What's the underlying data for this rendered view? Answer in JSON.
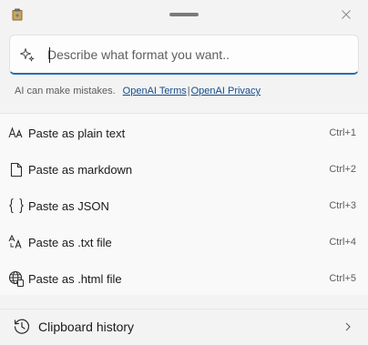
{
  "prompt": {
    "placeholder": "Describe what format you want..",
    "value": ""
  },
  "disclaimer": {
    "text": "AI can make mistakes.",
    "terms_link": "OpenAI Terms",
    "separator": "|",
    "privacy_link": "OpenAI Privacy"
  },
  "menu": {
    "items": [
      {
        "label": "Paste as plain text",
        "shortcut": "Ctrl+1",
        "icon": "text-aa-icon"
      },
      {
        "label": "Paste as markdown",
        "shortcut": "Ctrl+2",
        "icon": "document-icon"
      },
      {
        "label": "Paste as JSON",
        "shortcut": "Ctrl+3",
        "icon": "braces-icon"
      },
      {
        "label": "Paste as .txt file",
        "shortcut": "Ctrl+4",
        "icon": "text-file-icon"
      },
      {
        "label": "Paste as .html file",
        "shortcut": "Ctrl+5",
        "icon": "globe-file-icon"
      }
    ]
  },
  "history": {
    "label": "Clipboard history",
    "icon": "history-icon"
  },
  "colors": {
    "accent": "#1f6fb5",
    "link": "#154d8a",
    "background": "#f3f3f3",
    "menu_background": "#f9f9f9"
  }
}
